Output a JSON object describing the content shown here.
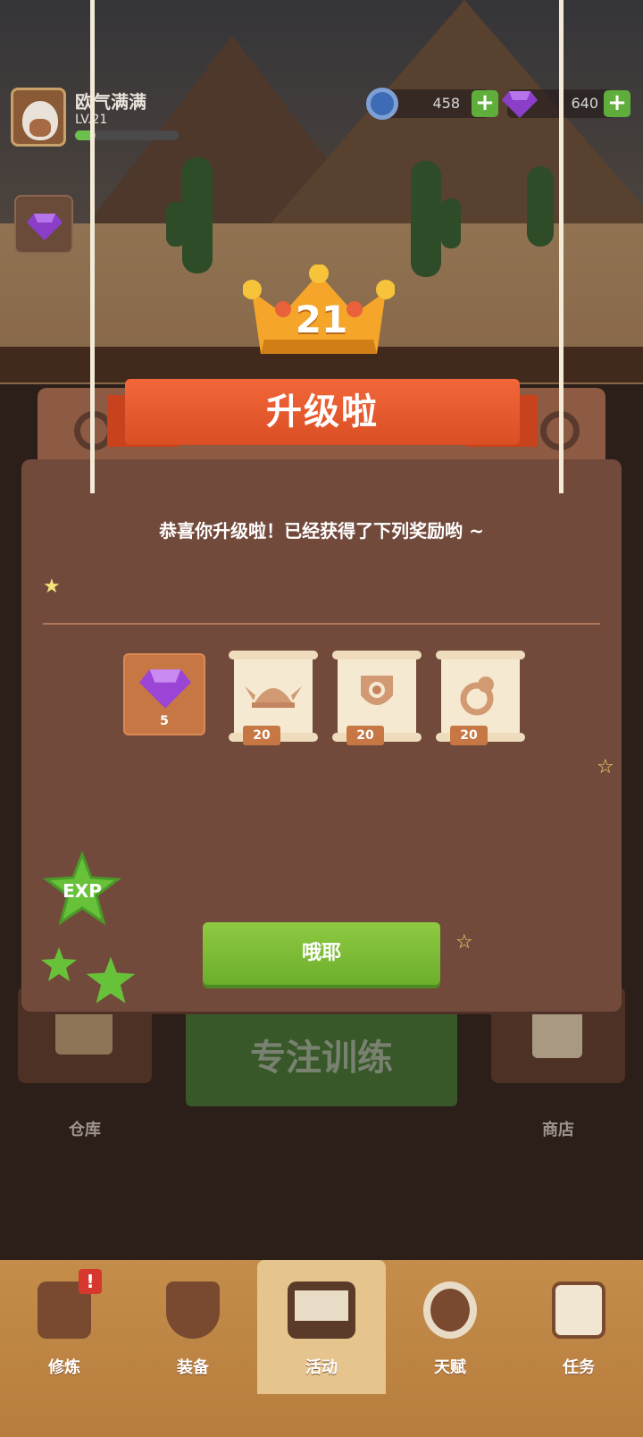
{
  "player": {
    "name": "欧气满满",
    "level_label": "LV.21",
    "level_progress": 0.2
  },
  "currency": {
    "coins": "458",
    "gems": "640",
    "plus_label": "+"
  },
  "levelup": {
    "level": "21",
    "title": "升级啦",
    "message": "恭喜你升级啦！已经获得了下列奖励哟 ~",
    "rewards": [
      {
        "type": "gem",
        "count": "5",
        "icon": "purple-gem-icon"
      },
      {
        "type": "helmet-scroll",
        "count": "20",
        "icon": "viking-helmet-icon"
      },
      {
        "type": "shield-scroll",
        "count": "20",
        "icon": "shield-icon"
      },
      {
        "type": "ring-scroll",
        "count": "20",
        "icon": "ring-icon"
      }
    ],
    "confirm_label": "哦耶",
    "exp_label": "EXP"
  },
  "home": {
    "train_label": "专注训练",
    "warehouse_label": "仓库",
    "shop_label": "商店"
  },
  "nav": {
    "items": [
      {
        "label": "修炼",
        "icon": "training-icon",
        "alert": "!"
      },
      {
        "label": "装备",
        "icon": "equipment-shield-icon"
      },
      {
        "label": "活动",
        "icon": "activity-board-icon",
        "active": true
      },
      {
        "label": "天赋",
        "icon": "talent-target-icon"
      },
      {
        "label": "任务",
        "icon": "task-clipboard-icon"
      }
    ]
  },
  "colors": {
    "banner": "#e85a2c",
    "modal": "#724a3c",
    "ok": "#7dbd37",
    "reward_tile": "#c77744"
  }
}
